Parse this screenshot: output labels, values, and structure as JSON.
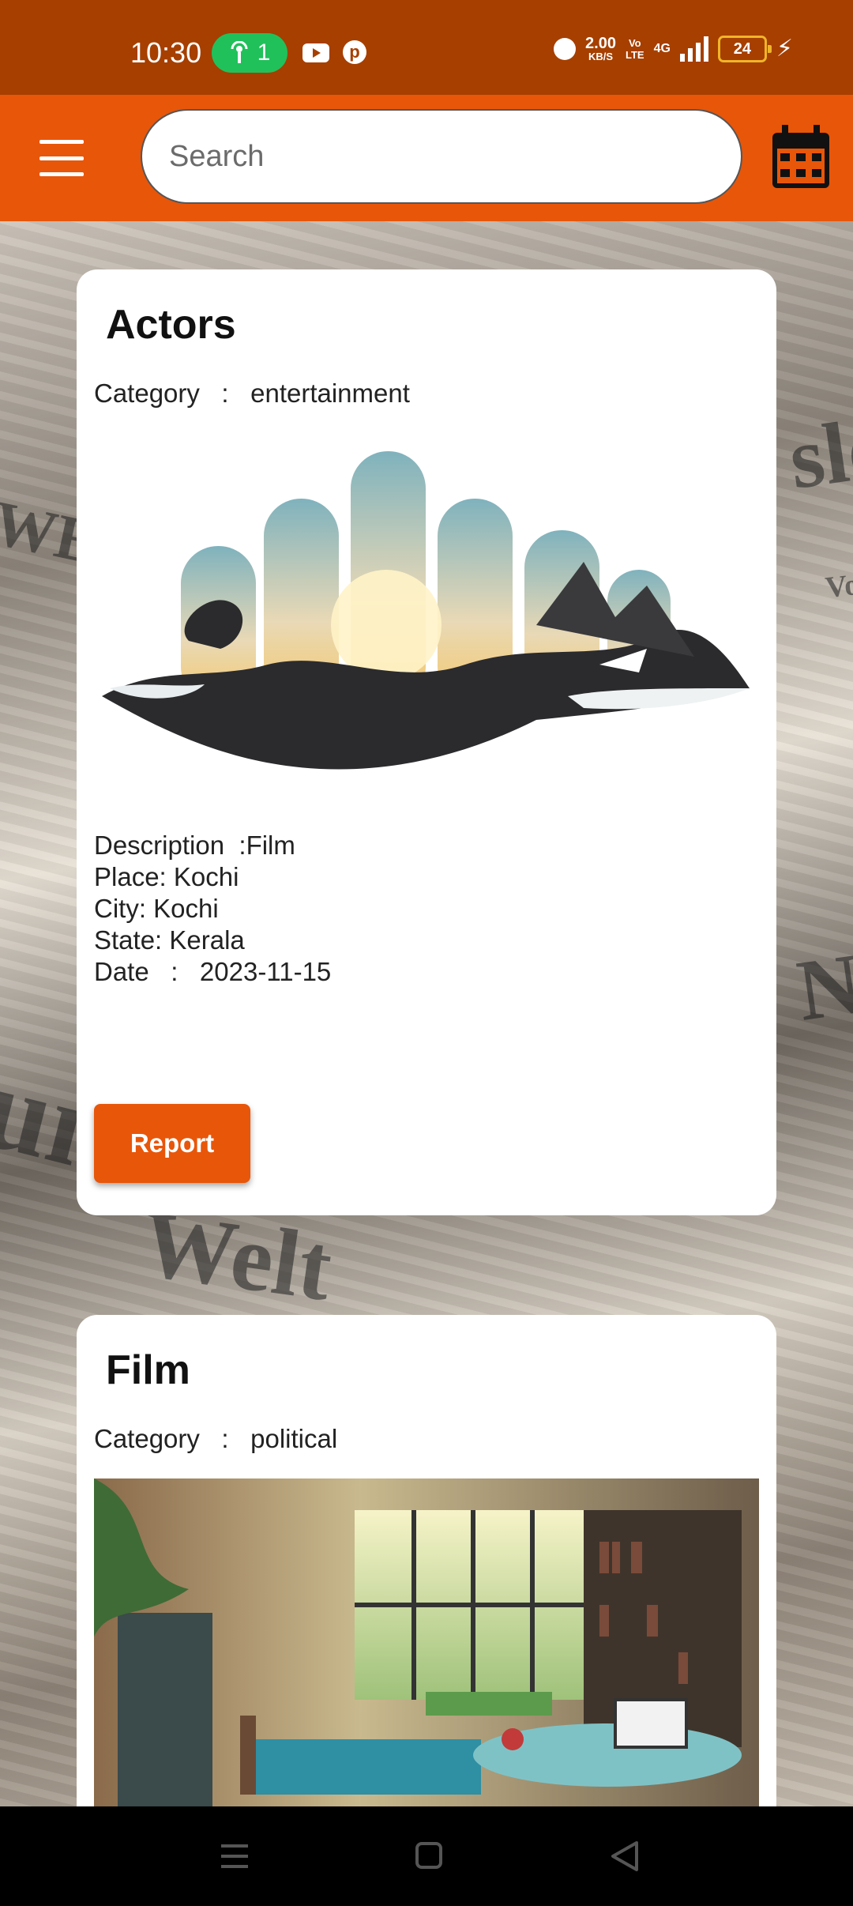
{
  "status_bar": {
    "time": "10:30",
    "hotspot_count": "1",
    "net_speed": "2.00",
    "net_speed_unit": "KB/S",
    "volte_line1": "Vo",
    "volte_line2": "LTE",
    "network_type": "4G",
    "battery_level": "24"
  },
  "app_bar": {
    "search_placeholder": "Search",
    "menu_icon": "hamburger-menu-icon",
    "calendar_icon": "calendar-icon"
  },
  "colors": {
    "status_bar_bg": "#a63f00",
    "accent": "#e8560a",
    "hotspot_pill": "#20c15a",
    "battery": "#f0b429"
  },
  "background": {
    "words": [
      "sle",
      "WEST",
      "NG",
      "ung",
      "Welt",
      "Vo"
    ]
  },
  "posts": [
    {
      "title": "Actors",
      "category_label": "Category",
      "category_sep": ":",
      "category": "entertainment",
      "description": "Description  :Film",
      "place": "Place: Kochi",
      "city": "City: Kochi",
      "state": "State: Kerala",
      "date_label": "Date",
      "date_sep": ":",
      "date": "2023-11-15",
      "report_label": "Report"
    },
    {
      "title": "Film",
      "category_label": "Category",
      "category_sep": ":",
      "category": "political"
    }
  ],
  "nav_bar": {
    "buttons": [
      "recent-apps-icon",
      "home-icon",
      "back-icon"
    ]
  }
}
